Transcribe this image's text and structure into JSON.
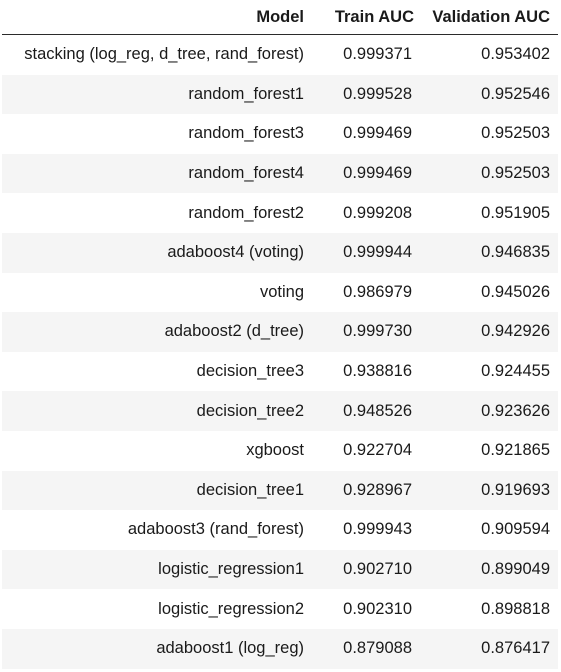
{
  "table": {
    "columns": [
      "Model",
      "Train AUC",
      "Validation AUC"
    ],
    "rows": [
      [
        "stacking (log_reg, d_tree, rand_forest)",
        "0.999371",
        "0.953402"
      ],
      [
        "random_forest1",
        "0.999528",
        "0.952546"
      ],
      [
        "random_forest3",
        "0.999469",
        "0.952503"
      ],
      [
        "random_forest4",
        "0.999469",
        "0.952503"
      ],
      [
        "random_forest2",
        "0.999208",
        "0.951905"
      ],
      [
        "adaboost4 (voting)",
        "0.999944",
        "0.946835"
      ],
      [
        "voting",
        "0.986979",
        "0.945026"
      ],
      [
        "adaboost2 (d_tree)",
        "0.999730",
        "0.942926"
      ],
      [
        "decision_tree3",
        "0.938816",
        "0.924455"
      ],
      [
        "decision_tree2",
        "0.948526",
        "0.923626"
      ],
      [
        "xgboost",
        "0.922704",
        "0.921865"
      ],
      [
        "decision_tree1",
        "0.928967",
        "0.919693"
      ],
      [
        "adaboost3 (rand_forest)",
        "0.999943",
        "0.909594"
      ],
      [
        "logistic_regression1",
        "0.902710",
        "0.899049"
      ],
      [
        "logistic_regression2",
        "0.902310",
        "0.898818"
      ],
      [
        "adaboost1 (log_reg)",
        "0.879088",
        "0.876417"
      ]
    ]
  }
}
